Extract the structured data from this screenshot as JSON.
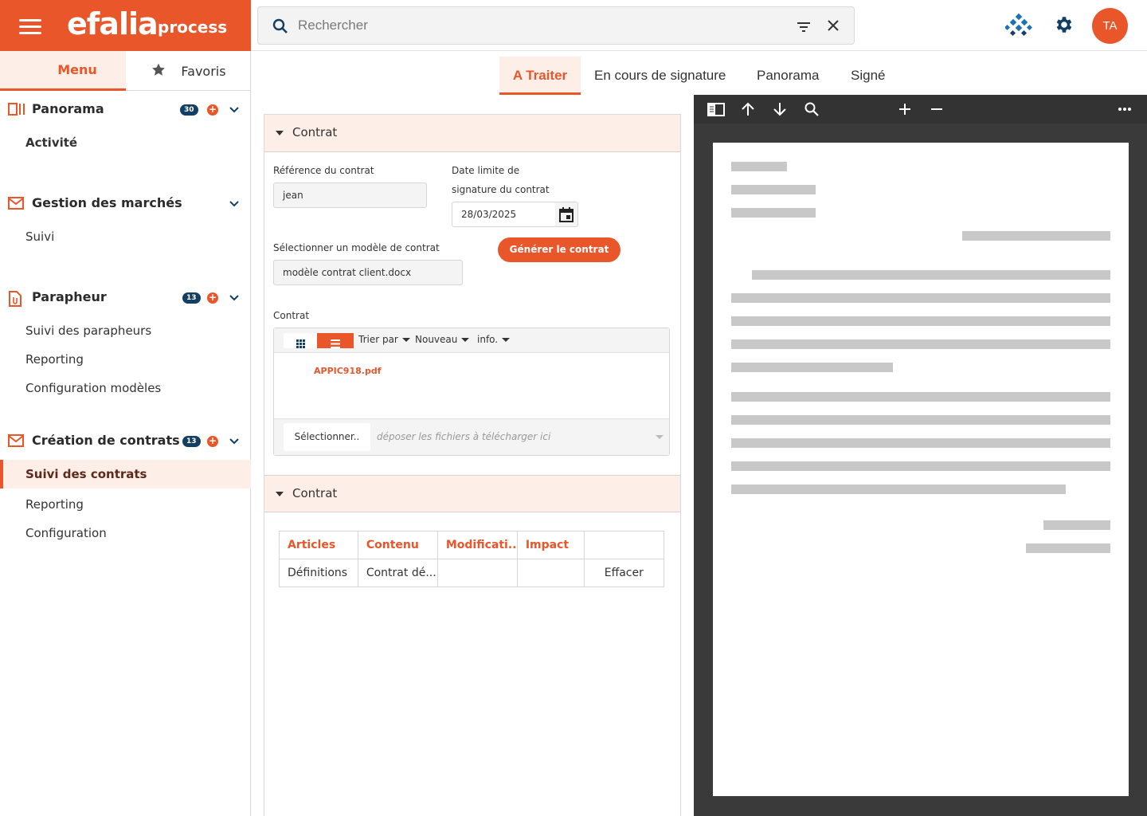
{
  "brand": {
    "name": "efalia",
    "subtitle": "process"
  },
  "sidebar": {
    "tabs": {
      "menu": "Menu",
      "favorites": "Favoris"
    },
    "sections": [
      {
        "title": "Panorama",
        "badge": "30",
        "items": [
          "Activité"
        ]
      },
      {
        "title": "Gestion des marchés",
        "items": [
          "Suivi"
        ]
      },
      {
        "title": "Parapheur",
        "badge": "13",
        "items": [
          "Suivi des parapheurs",
          "Reporting",
          "Configuration modèles"
        ]
      },
      {
        "title": "Création de contrats",
        "badge": "13",
        "items": [
          "Suivi des contrats",
          "Reporting",
          "Configuration"
        ],
        "active_item": "Suivi des contrats"
      }
    ]
  },
  "header": {
    "search_placeholder": "Rechercher",
    "avatar_initials": "TA"
  },
  "tabs": [
    "A Traiter",
    "En cours de signature",
    "Panorama",
    "Signé"
  ],
  "form": {
    "section1_title": "Contrat",
    "reference_label": "Référence du contrat",
    "reference_value": "jean",
    "deadline_label_line1": "Date limite de",
    "deadline_label_line2": "signature du contrat",
    "deadline_value": "28/03/2025",
    "model_label": "Sélectionner un modèle de contrat",
    "model_value": "modèle contrat client.docx",
    "generate_button": "Générer le contrat",
    "contract_label": "Contrat",
    "toolbar": {
      "sort": "Trier par",
      "new": "Nouveau",
      "info": "info."
    },
    "file_name": "APPIC918.pdf",
    "select_button": "Sélectionner..",
    "drop_hint": "déposer les fichiers à télécharger ici",
    "section2_title": "Contrat",
    "table": {
      "headers": [
        "Articles",
        "Contenu",
        "Modificati..",
        "Impact",
        ""
      ],
      "rows": [
        [
          "Définitions",
          "Contrat dé...",
          "",
          "",
          "Effacer"
        ]
      ]
    }
  },
  "colors": {
    "accent": "#e8562a",
    "badge": "#123f63",
    "viewer_bg": "#3a3a3a"
  }
}
